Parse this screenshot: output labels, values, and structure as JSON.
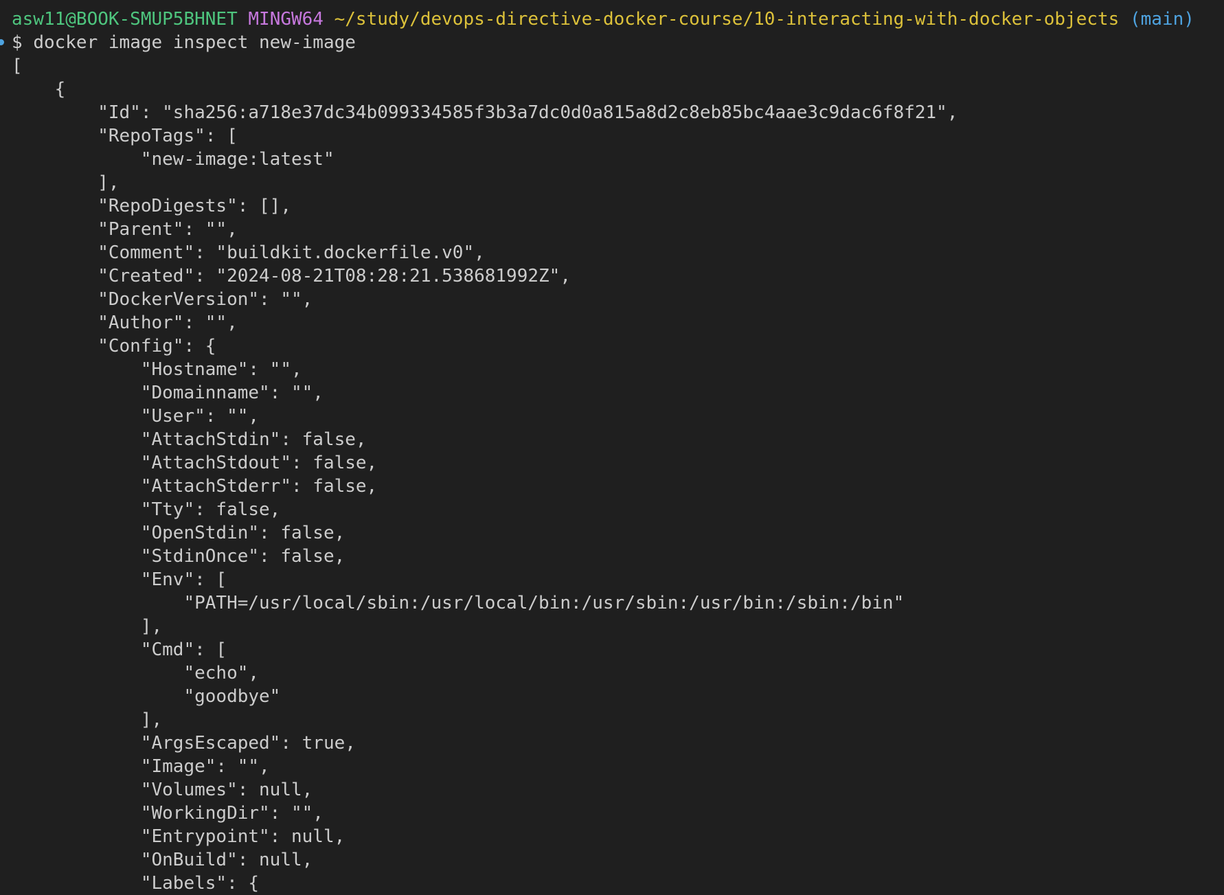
{
  "prompt": {
    "user": "asw11@BOOK-SMUP5BHNET",
    "system": "MINGW64",
    "path": "~/study/devops-directive-docker-course/10-interacting-with-docker-objects",
    "branch": "(main)",
    "symbol": "$",
    "command": "docker image inspect new-image"
  },
  "colors": {
    "background": "#1f1f1f",
    "text": "#cccccc",
    "user": "#4ec57e",
    "system": "#c678dd",
    "path": "#dcc13a",
    "branch": "#4ea3e0"
  },
  "output": [
    "[",
    "    {",
    "        \"Id\": \"sha256:a718e37dc34b099334585f3b3a7dc0d0a815a8d2c8eb85bc4aae3c9dac6f8f21\",",
    "        \"RepoTags\": [",
    "            \"new-image:latest\"",
    "        ],",
    "        \"RepoDigests\": [],",
    "        \"Parent\": \"\",",
    "        \"Comment\": \"buildkit.dockerfile.v0\",",
    "        \"Created\": \"2024-08-21T08:28:21.538681992Z\",",
    "        \"DockerVersion\": \"\",",
    "        \"Author\": \"\",",
    "        \"Config\": {",
    "            \"Hostname\": \"\",",
    "            \"Domainname\": \"\",",
    "            \"User\": \"\",",
    "            \"AttachStdin\": false,",
    "            \"AttachStdout\": false,",
    "            \"AttachStderr\": false,",
    "            \"Tty\": false,",
    "            \"OpenStdin\": false,",
    "            \"StdinOnce\": false,",
    "            \"Env\": [",
    "                \"PATH=/usr/local/sbin:/usr/local/bin:/usr/sbin:/usr/bin:/sbin:/bin\"",
    "            ],",
    "            \"Cmd\": [",
    "                \"echo\",",
    "                \"goodbye\"",
    "            ],",
    "            \"ArgsEscaped\": true,",
    "            \"Image\": \"\",",
    "            \"Volumes\": null,",
    "            \"WorkingDir\": \"\",",
    "            \"Entrypoint\": null,",
    "            \"OnBuild\": null,",
    "            \"Labels\": {"
  ]
}
